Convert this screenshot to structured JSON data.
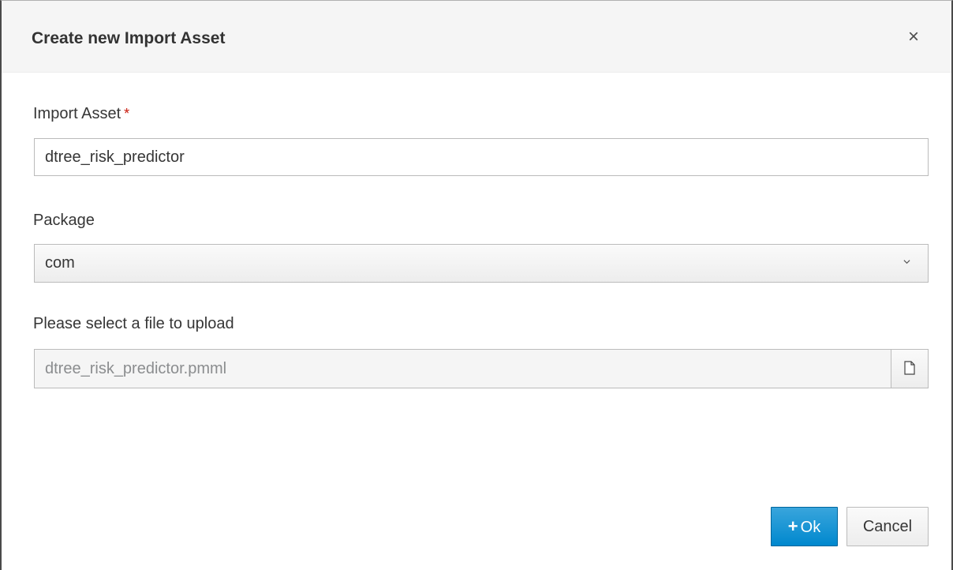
{
  "dialog": {
    "title": "Create new Import Asset",
    "close_icon": "×"
  },
  "form": {
    "import_asset": {
      "label": "Import Asset",
      "required_marker": "*",
      "value": "dtree_risk_predictor"
    },
    "package": {
      "label": "Package",
      "selected": "com"
    },
    "file": {
      "label": "Please select a file to upload",
      "value": "dtree_risk_predictor.pmml",
      "browse_icon": "file-icon"
    }
  },
  "buttons": {
    "ok_icon": "+",
    "ok_label": "Ok",
    "cancel_label": "Cancel"
  },
  "colors": {
    "primary": "#0088ce",
    "required": "#c9190b",
    "header_bg": "#f5f5f5"
  }
}
